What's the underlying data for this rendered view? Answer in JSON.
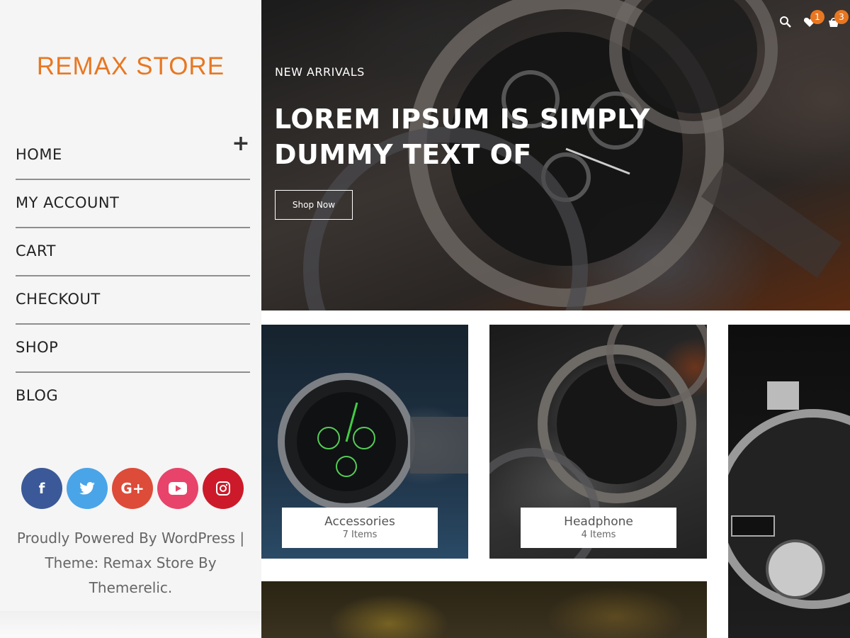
{
  "brand": {
    "logo": "REMAX STORE",
    "accent": "#e87722"
  },
  "nav": {
    "items": [
      {
        "label": "HOME",
        "has_submenu": true
      },
      {
        "label": "MY ACCOUNT"
      },
      {
        "label": "CART"
      },
      {
        "label": "CHECKOUT"
      },
      {
        "label": "SHOP"
      },
      {
        "label": "BLOG"
      }
    ],
    "submenu_icon": "plus-icon"
  },
  "social": [
    {
      "name": "facebook",
      "glyph": "f"
    },
    {
      "name": "twitter",
      "glyph": "t"
    },
    {
      "name": "google-plus",
      "glyph": "G+"
    },
    {
      "name": "youtube",
      "glyph": "▶"
    },
    {
      "name": "instagram",
      "glyph": "◎"
    }
  ],
  "footer": {
    "line1": "Proudly Powered By WordPress |",
    "line2": "Theme: Remax Store By",
    "line3": "Themerelic."
  },
  "header_icons": {
    "search": "search-icon",
    "wishlist": {
      "icon": "heart-icon",
      "count": "1"
    },
    "cart": {
      "icon": "cart-icon",
      "count": "3"
    }
  },
  "hero": {
    "kicker": "NEW ARRIVALS",
    "title": "LOREM IPSUM IS SIMPLY DUMMY TEXT OF",
    "button": "Shop Now"
  },
  "categories": [
    {
      "name": "Accessories",
      "count": "7 Items"
    },
    {
      "name": "Headphone",
      "count": "4 Items"
    }
  ]
}
